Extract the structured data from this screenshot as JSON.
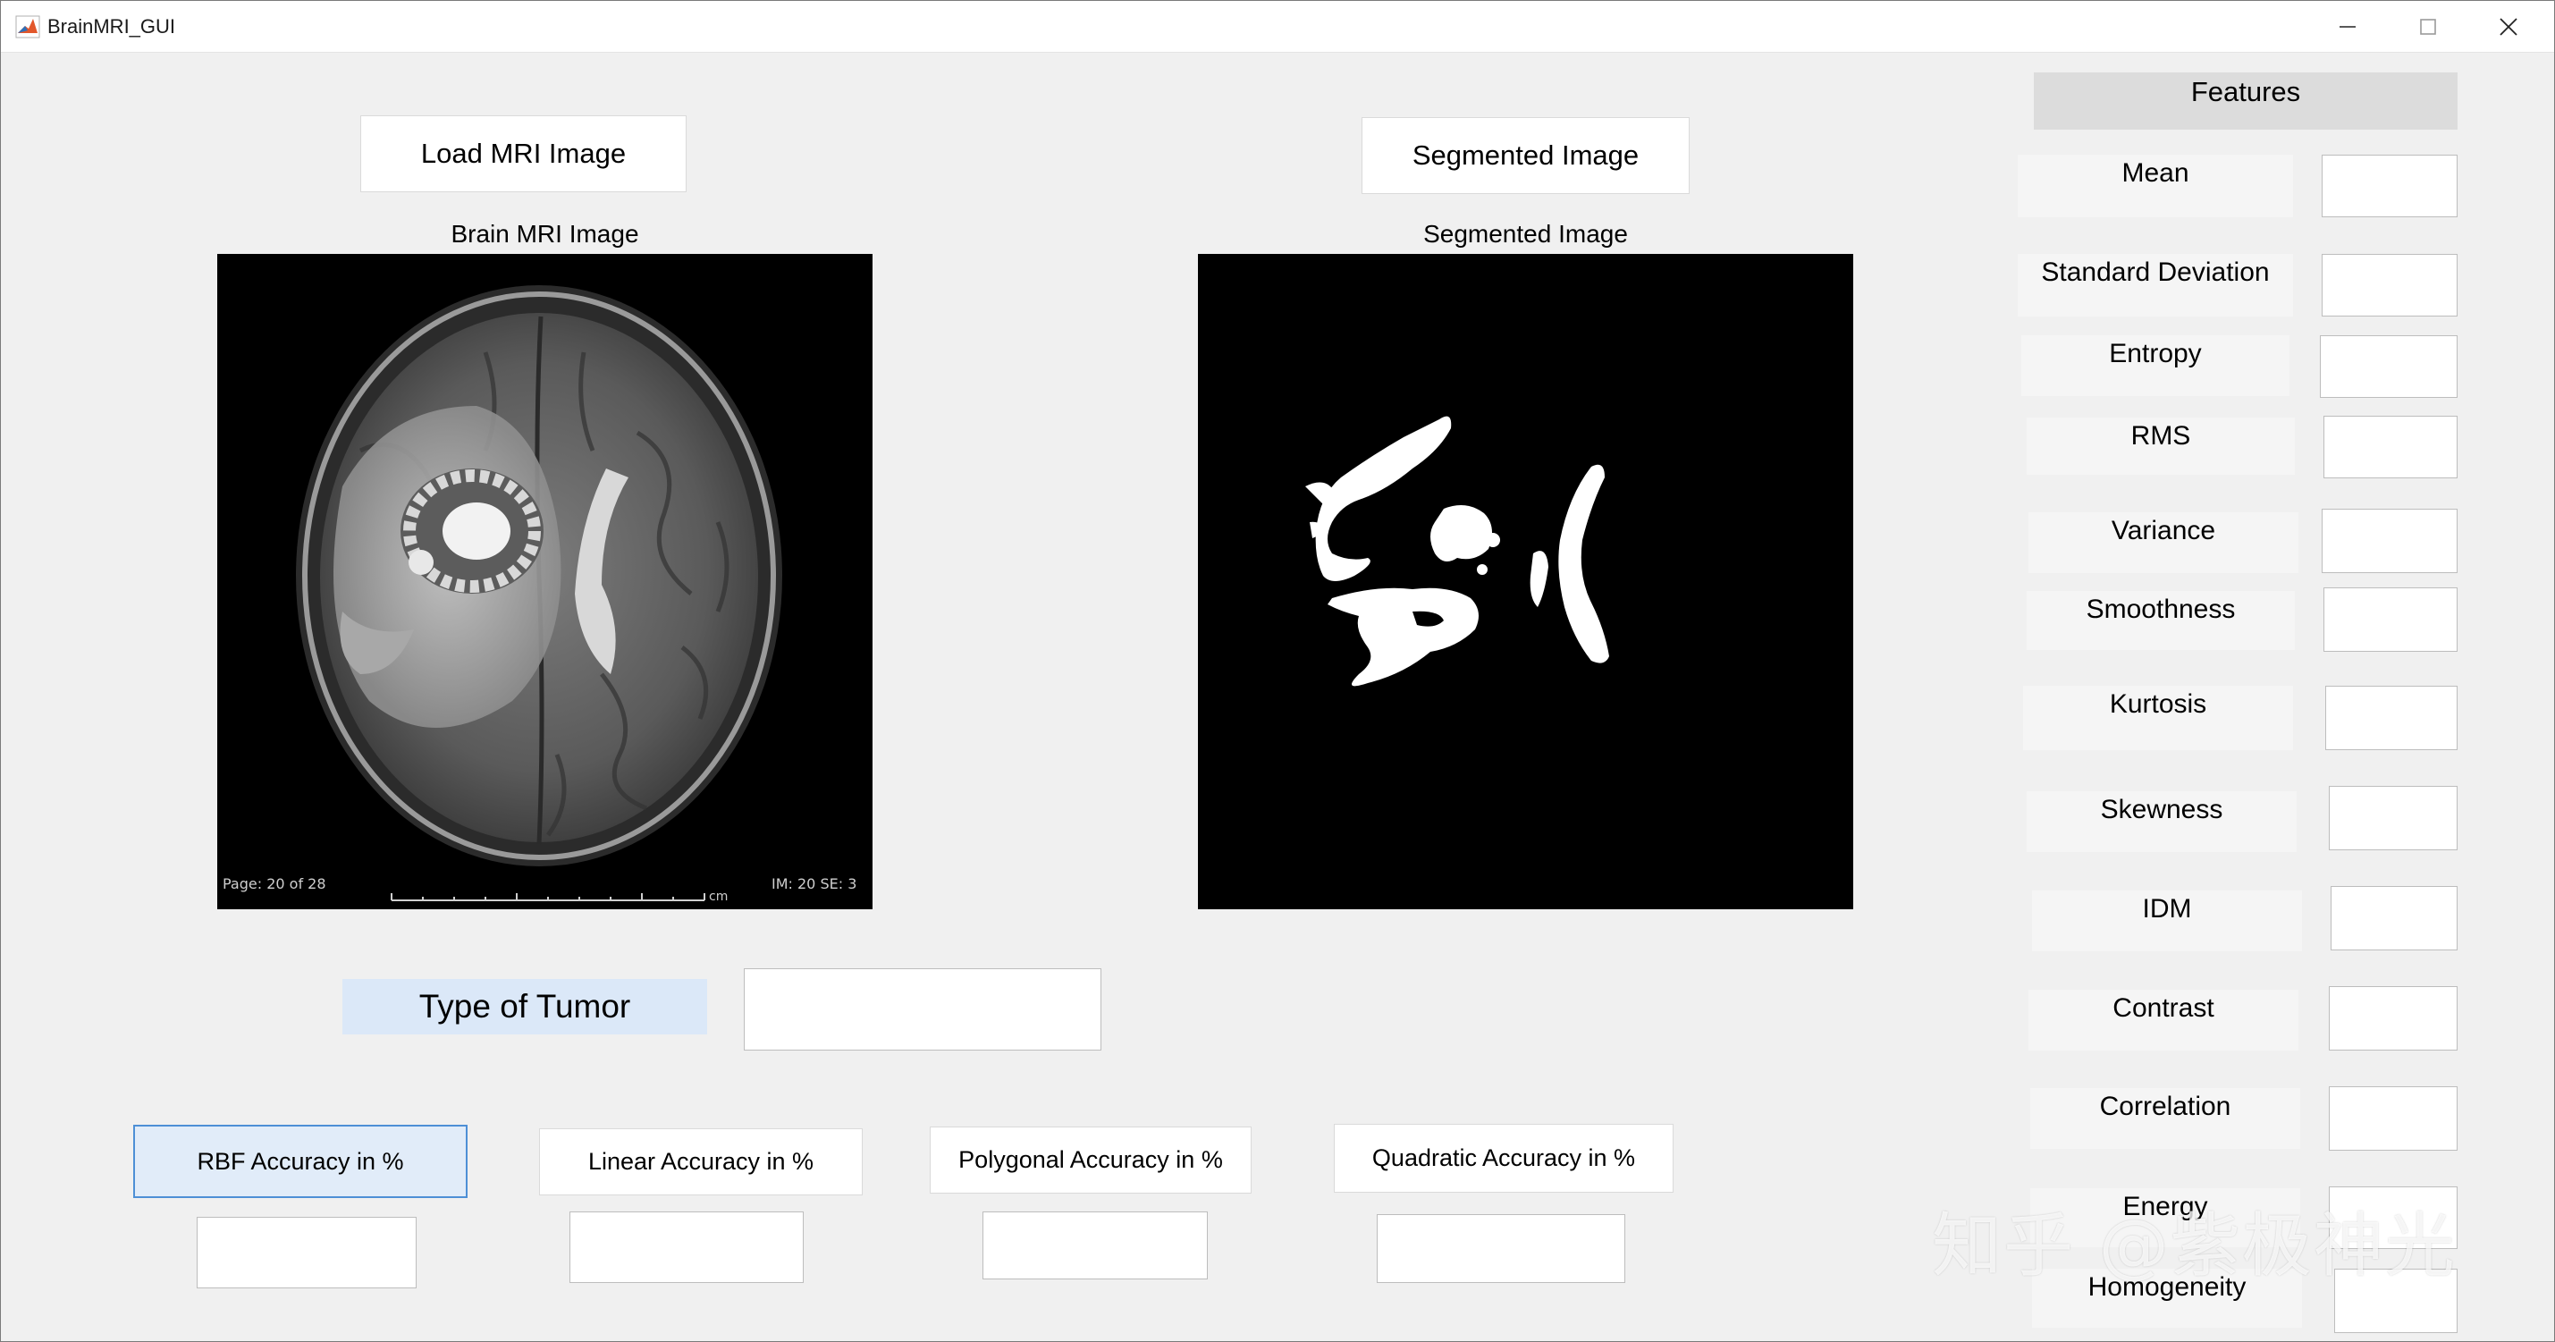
{
  "window": {
    "title": "BrainMRI_GUI"
  },
  "buttons": {
    "load": "Load MRI Image",
    "segmented": "Segmented Image",
    "rbf": "RBF Accuracy in %",
    "linear": "Linear Accuracy in %",
    "polygonal": "Polygonal Accuracy in %",
    "quadratic": "Quadratic Accuracy in %"
  },
  "captions": {
    "brain": "Brain MRI Image",
    "segmented": "Segmented Image",
    "tumor_type": "Type of Tumor"
  },
  "mri_overlay": {
    "page": "Page: 20 of 28",
    "series": "IM: 20 SE: 3",
    "unit": "cm"
  },
  "features": {
    "header": "Features",
    "items": [
      "Mean",
      "Standard Deviation",
      "Entropy",
      "RMS",
      "Variance",
      "Smoothness",
      "Kurtosis",
      "Skewness",
      "IDM",
      "Contrast",
      "Correlation",
      "Energy",
      "Homogeneity"
    ]
  },
  "watermark": "知乎 @紫极神光",
  "colors": {
    "window_bg": "#f0f0f0",
    "selected_button": "#e1ecf9",
    "selected_border": "#4d8fd6",
    "tumor_label_bg": "#dbe8f8"
  }
}
